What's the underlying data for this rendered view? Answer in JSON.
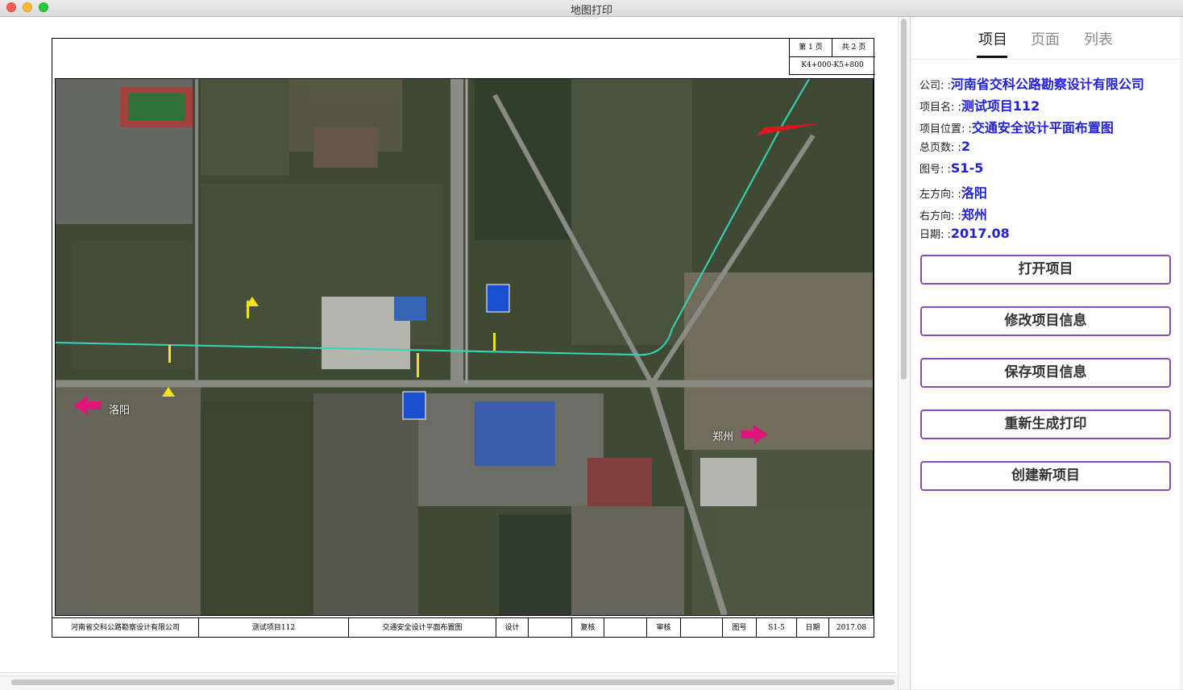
{
  "window": {
    "title": "地图打印"
  },
  "sheet": {
    "page_label": "第 1 页",
    "total_label": "共 2 页",
    "range": "K4+000-K5+800",
    "map_labels": {
      "left_city": "洛阳",
      "right_city": "郑州"
    },
    "title_block": {
      "company": "河南省交科公路勘察设计有限公司",
      "project": "测试项目112",
      "drawing": "交通安全设计平面布置图",
      "design_label": "设计",
      "design_value": "",
      "review_label": "复核",
      "review_value": "",
      "approve_label": "审核",
      "approve_value": "",
      "figno_label": "图号",
      "figno_value": "S1-5",
      "date_label": "日期",
      "date_value": "2017.08"
    }
  },
  "panel": {
    "tabs": [
      "项目",
      "页面",
      "列表"
    ],
    "active_tab": "项目",
    "fields": [
      {
        "label": "公司: :",
        "value": "河南省交科公路勘察设计有限公司"
      },
      {
        "label": "项目名: :",
        "value": "测试项目112"
      },
      {
        "label": "项目位置: :",
        "value": "交通安全设计平面布置图"
      },
      {
        "label": "总页数: :",
        "value": "2"
      },
      {
        "label": "图号: :",
        "value": "S1-5"
      },
      {
        "label": "左方向: :",
        "value": "洛阳"
      },
      {
        "label": "右方向: :",
        "value": "郑州"
      },
      {
        "label": "日期: :",
        "value": "2017.08"
      }
    ],
    "buttons": [
      "打开项目",
      "修改项目信息",
      "保存项目信息",
      "重新生成打印",
      "创建新项目"
    ],
    "value_color": "#1f1fd6",
    "button_border_color": "#8a4bb8"
  }
}
